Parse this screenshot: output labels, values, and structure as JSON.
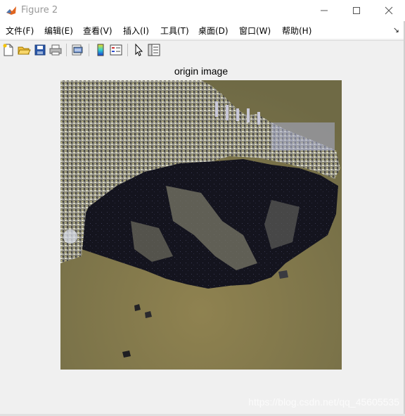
{
  "window": {
    "title": "Figure 2",
    "controls": {
      "minimize": "—",
      "maximize": "☐",
      "close": "✕"
    }
  },
  "menu": {
    "items": [
      "文件(F)",
      "编辑(E)",
      "查看(V)",
      "插入(I)",
      "工具(T)",
      "桌面(D)",
      "窗口(W)",
      "帮助(H)"
    ],
    "overflow_arrow": "↘"
  },
  "toolbar": {
    "buttons": [
      "new-figure-icon",
      "open-file-icon",
      "save-icon",
      "print-icon",
      "print-preview-icon",
      "colorbar-icon",
      "legend-icon",
      "pointer-icon",
      "property-inspector-icon"
    ]
  },
  "figure": {
    "axes_title": "origin image",
    "image_description_icon": "satellite-image"
  },
  "watermark": "https://blog.csdn.net/qq_45605535",
  "colors": {
    "background": "#f0f0f0",
    "titlebar": "#ffffff",
    "water": "#8b7d4b",
    "dark_terrain": "#14141e",
    "urban": "#9c9a8a"
  }
}
